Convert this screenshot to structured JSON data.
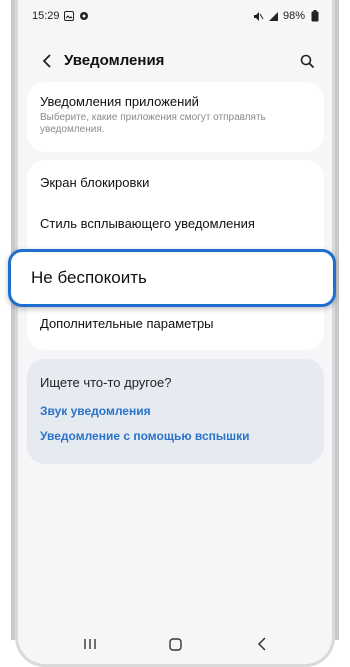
{
  "status": {
    "time": "15:29",
    "battery": "98%"
  },
  "header": {
    "title": "Уведомления"
  },
  "settings": {
    "app_notifications": {
      "title": "Уведомления приложений",
      "desc": "Выберите, какие приложения смогут отправлять уведомления."
    },
    "lock_screen": "Экран блокировки",
    "popup_style": "Стиль всплывающего уведомления",
    "do_not_disturb": "Не беспокоить",
    "advanced": "Дополнительные параметры"
  },
  "suggestions": {
    "title": "Ищете что-то другое?",
    "links": [
      "Звук уведомления",
      "Уведомление с помощью вспышки"
    ]
  },
  "colors": {
    "accent": "#1f6fd1",
    "link": "#2a73c9",
    "suggest_bg": "#e6ebf2"
  }
}
